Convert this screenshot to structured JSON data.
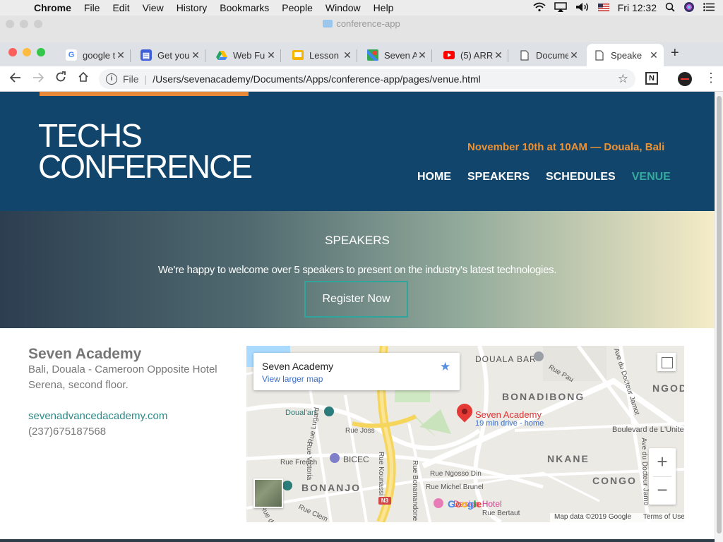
{
  "menubar": {
    "app": "Chrome",
    "items": [
      "File",
      "Edit",
      "View",
      "History",
      "Bookmarks",
      "People",
      "Window",
      "Help"
    ],
    "clock": "Fri 12:32"
  },
  "ghost_window": {
    "title": "conference-app"
  },
  "tabs": [
    {
      "label": "google t",
      "icon": "google-icon",
      "color": "#4285f4"
    },
    {
      "label": "Get you",
      "icon": "google-sites-icon",
      "color": "#3f5fd8"
    },
    {
      "label": "Web Fu",
      "icon": "google-drive-icon",
      "color": "#1fa463"
    },
    {
      "label": "Lesson",
      "icon": "google-slides-icon",
      "color": "#f4b400"
    },
    {
      "label": "Seven A",
      "icon": "google-maps-icon",
      "color": "#34a853"
    },
    {
      "label": "(5) ARR",
      "icon": "youtube-icon",
      "color": "#ff0000"
    },
    {
      "label": "Docume",
      "icon": "document-icon",
      "color": "#666666"
    },
    {
      "label": "Speake",
      "icon": "document-icon",
      "color": "#666666",
      "active": true
    }
  ],
  "address": {
    "scheme": "File",
    "url": "/Users/sevenacademy/Documents/Apps/conference-app/pages/venue.html"
  },
  "site": {
    "logo_line1": "TECHS",
    "logo_line2": "CONFERENCE",
    "date": "November 10th at 10AM — Douala, Bali",
    "nav": [
      "HOME",
      "SPEAKERS",
      "SCHEDULES",
      "VENUE"
    ],
    "current_nav": "VENUE",
    "accent_color": "#f0912f",
    "header_bg": "#12456b"
  },
  "banner": {
    "heading": "SPEAKERS",
    "text": "We're happy to welcome over 5 speakers to present on the industry's latest technologies.",
    "button": "Register Now"
  },
  "venue": {
    "name": "Seven Academy",
    "address": "Bali, Douala - Cameroon Opposite Hotel Serena, second floor.",
    "website": "sevenadvancedacademy.com",
    "phone": "(237)675187568"
  },
  "map": {
    "card_title": "Seven Academy",
    "card_link": "View larger map",
    "pin_label": "Seven Academy",
    "pin_sub": "19 min drive - home",
    "labels": {
      "douala_bar": "DOUALA BAR",
      "bonadibong": "BONADIBONG",
      "ngod": "NGOD",
      "doualart": "Doual'art",
      "rue_joss": "Rue Joss",
      "boulevard": "Boulevard de L'Unite",
      "bicec": "BICEC",
      "rue_french": "Rue French",
      "nkane": "NKANE",
      "rue_ngosso": "Rue Ngosso Din",
      "rue_michel": "Rue Michel Brunel",
      "bonanjo": "BONANJO",
      "congo": "CONGO",
      "design_hotel": "Design Hotel",
      "rue_bertaut": "Rue Bertaut",
      "rue_pau": "Rue Pau",
      "rue_kounassi": "Rue Kounassi",
      "rue_lugard": "Rue Lugard",
      "rue_victoria": "Rue Victoria",
      "rue_bonamandone": "Rue Bonamandone",
      "ave_jamot_1": "Ave du Docteur Jamot",
      "ave_jamot_2": "Ave du Docteur Jamo",
      "rue_clem": "Rue Clem",
      "rue_de": "Rue de",
      "n3": "N3"
    },
    "google": "Google",
    "attribution": "Map data ©2019 Google",
    "terms": "Terms of Use"
  }
}
